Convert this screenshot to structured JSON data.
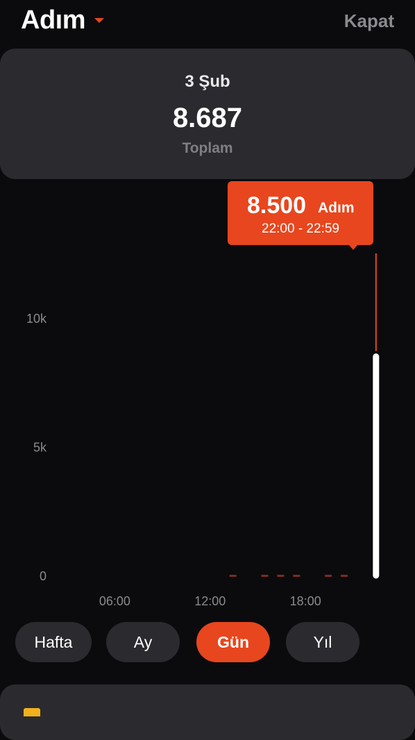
{
  "header": {
    "title": "Adım",
    "close_label": "Kapat"
  },
  "summary": {
    "date": "3 Şub",
    "total": "8.687",
    "total_label": "Toplam"
  },
  "tooltip": {
    "value": "8.500",
    "unit": "Adım",
    "range": "22:00 - 22:59"
  },
  "colors": {
    "accent": "#e8461e",
    "card": "#2b2b2f",
    "background": "#0b0b0e"
  },
  "chart_data": {
    "type": "bar",
    "y_ticks": [
      "10k",
      "5k",
      "0"
    ],
    "x_ticks": [
      "06:00",
      "12:00",
      "18:00"
    ],
    "ylim": [
      0,
      10000
    ],
    "hours": [
      13,
      15,
      16,
      17,
      19,
      20,
      22
    ],
    "values": [
      20,
      20,
      20,
      20,
      20,
      20,
      8500
    ],
    "selected_hour": 22
  },
  "tabs": [
    {
      "label": "Hafta",
      "active": false
    },
    {
      "label": "Ay",
      "active": false
    },
    {
      "label": "Gün",
      "active": true
    },
    {
      "label": "Yıl",
      "active": false
    }
  ]
}
